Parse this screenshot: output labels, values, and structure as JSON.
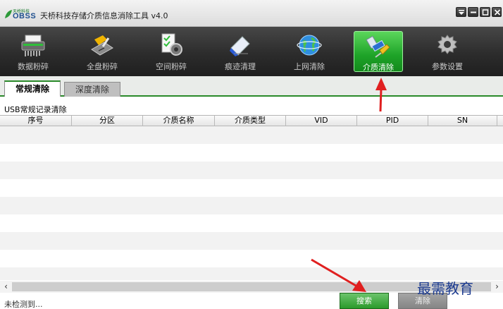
{
  "window": {
    "logo_small": "天桥科技",
    "logo_big": "OBSS",
    "title": "天桥科技存储介质信息消除工具 v4.0"
  },
  "toolbar": {
    "items": [
      {
        "label": "数据粉碎",
        "icon": "shredder-icon"
      },
      {
        "label": "全盘粉碎",
        "icon": "disk-shred-icon"
      },
      {
        "label": "空间粉碎",
        "icon": "space-shred-icon"
      },
      {
        "label": "痕迹清理",
        "icon": "eraser-icon"
      },
      {
        "label": "上网清除",
        "icon": "globe-icon"
      },
      {
        "label": "介质清除",
        "icon": "usb-brush-icon"
      },
      {
        "label": "参数设置",
        "icon": "gear-icon"
      }
    ],
    "active_index": 5
  },
  "tabs": [
    {
      "label": "常规清除"
    },
    {
      "label": "深度清除"
    }
  ],
  "section": {
    "title": "USB常规记录清除"
  },
  "table": {
    "columns": [
      "序号",
      "分区",
      "介质名称",
      "介质类型",
      "VID",
      "PID",
      "SN"
    ],
    "rows": []
  },
  "scroll": {
    "left_arrow": "‹",
    "right_arrow": "›"
  },
  "bottom": {
    "status": "未检测到...",
    "search_label": "搜索",
    "clear_label": "清除"
  },
  "watermark": "最需教育",
  "colors": {
    "accent_green": "#1ea328",
    "annotation_red": "#e02020",
    "watermark_blue": "#1b3a8f"
  }
}
